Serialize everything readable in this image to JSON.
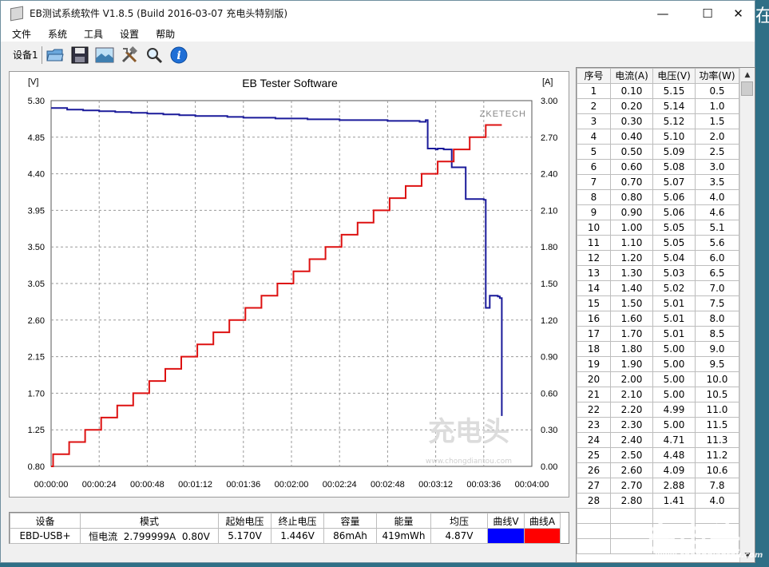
{
  "window": {
    "title": "EB测试系统软件 V1.8.5 (Build 2016-03-07 充电头特别版)",
    "controls": {
      "minimize": "—",
      "maximize": "☐",
      "close": "✕"
    }
  },
  "menu": [
    "文件",
    "系统",
    "工具",
    "设置",
    "帮助"
  ],
  "toolbar": {
    "device_label": "设备1",
    "buttons": [
      "open-folder-icon",
      "save-disk-icon",
      "landscape-image-icon",
      "tools-icon",
      "zoom-magnifier-icon",
      "info-icon"
    ]
  },
  "chart": {
    "watermark_brand": "ZKETECH",
    "watermark_site": "www.chongdiantou.com",
    "watermark_logo": "充电头",
    "left_unit": "[V]",
    "right_unit": "[A]"
  },
  "chart_data": {
    "type": "line",
    "title": "EB Tester Software",
    "xlabel": "",
    "ylabel_left": "[V]",
    "ylabel_right": "[A]",
    "x_ticks": [
      "00:00:00",
      "00:00:24",
      "00:00:48",
      "00:01:12",
      "00:01:36",
      "00:02:00",
      "00:02:24",
      "00:02:48",
      "00:03:12",
      "00:03:36",
      "00:04:00"
    ],
    "xlim_seconds": [
      0,
      240
    ],
    "y_left_ticks": [
      "5.30",
      "4.85",
      "4.40",
      "3.95",
      "3.50",
      "3.05",
      "2.60",
      "2.15",
      "1.70",
      "1.25",
      "0.80"
    ],
    "y_left_lim": [
      0.8,
      5.3
    ],
    "y_right_ticks": [
      "3.00",
      "2.70",
      "2.40",
      "2.10",
      "1.80",
      "1.50",
      "1.20",
      "0.90",
      "0.60",
      "0.30",
      "0.00"
    ],
    "y_right_lim": [
      0.0,
      3.0
    ],
    "grid": true,
    "series": [
      {
        "name": "曲线V",
        "axis": "left",
        "color": "#1a1a9a",
        "points": [
          [
            0,
            5.21
          ],
          [
            8,
            5.19
          ],
          [
            16,
            5.18
          ],
          [
            24,
            5.17
          ],
          [
            32,
            5.16
          ],
          [
            40,
            5.15
          ],
          [
            48,
            5.14
          ],
          [
            56,
            5.13
          ],
          [
            64,
            5.12
          ],
          [
            72,
            5.11
          ],
          [
            80,
            5.11
          ],
          [
            88,
            5.1
          ],
          [
            96,
            5.09
          ],
          [
            104,
            5.09
          ],
          [
            112,
            5.08
          ],
          [
            120,
            5.08
          ],
          [
            128,
            5.07
          ],
          [
            136,
            5.07
          ],
          [
            144,
            5.06
          ],
          [
            152,
            5.06
          ],
          [
            160,
            5.06
          ],
          [
            168,
            5.05
          ],
          [
            176,
            5.05
          ],
          [
            182,
            5.05
          ],
          [
            184,
            5.04
          ],
          [
            187,
            5.06
          ],
          [
            188,
            4.71
          ],
          [
            191,
            4.71
          ],
          [
            192,
            4.7
          ],
          [
            193,
            4.71
          ],
          [
            196,
            4.7
          ],
          [
            200,
            4.7
          ],
          [
            200,
            4.48
          ],
          [
            206,
            4.48
          ],
          [
            207,
            4.09
          ],
          [
            215,
            4.09
          ],
          [
            216,
            4.08
          ],
          [
            217,
            2.75
          ],
          [
            219,
            2.75
          ],
          [
            219,
            2.9
          ],
          [
            223,
            2.89
          ],
          [
            224,
            2.87
          ],
          [
            225,
            1.42
          ]
        ]
      },
      {
        "name": "曲线A",
        "axis": "right",
        "color": "#dd1111",
        "steps": [
          [
            0,
            0.0
          ],
          [
            1,
            0.1
          ],
          [
            9,
            0.2
          ],
          [
            17,
            0.3
          ],
          [
            25,
            0.4
          ],
          [
            33,
            0.5
          ],
          [
            41,
            0.6
          ],
          [
            49,
            0.7
          ],
          [
            57,
            0.8
          ],
          [
            65,
            0.9
          ],
          [
            73,
            1.0
          ],
          [
            81,
            1.1
          ],
          [
            89,
            1.2
          ],
          [
            97,
            1.3
          ],
          [
            105,
            1.4
          ],
          [
            113,
            1.5
          ],
          [
            121,
            1.6
          ],
          [
            129,
            1.7
          ],
          [
            137,
            1.8
          ],
          [
            145,
            1.9
          ],
          [
            153,
            2.0
          ],
          [
            161,
            2.1
          ],
          [
            169,
            2.2
          ],
          [
            177,
            2.3
          ],
          [
            185,
            2.4
          ],
          [
            193,
            2.5
          ],
          [
            201,
            2.6
          ],
          [
            209,
            2.7
          ],
          [
            217,
            2.8
          ],
          [
            225,
            2.8
          ]
        ]
      }
    ]
  },
  "table": {
    "headers": [
      "序号",
      "电流(A)",
      "电压(V)",
      "功率(W)"
    ],
    "rows": [
      [
        "1",
        "0.10",
        "5.15",
        "0.5"
      ],
      [
        "2",
        "0.20",
        "5.14",
        "1.0"
      ],
      [
        "3",
        "0.30",
        "5.12",
        "1.5"
      ],
      [
        "4",
        "0.40",
        "5.10",
        "2.0"
      ],
      [
        "5",
        "0.50",
        "5.09",
        "2.5"
      ],
      [
        "6",
        "0.60",
        "5.08",
        "3.0"
      ],
      [
        "7",
        "0.70",
        "5.07",
        "3.5"
      ],
      [
        "8",
        "0.80",
        "5.06",
        "4.0"
      ],
      [
        "9",
        "0.90",
        "5.06",
        "4.6"
      ],
      [
        "10",
        "1.00",
        "5.05",
        "5.1"
      ],
      [
        "11",
        "1.10",
        "5.05",
        "5.6"
      ],
      [
        "12",
        "1.20",
        "5.04",
        "6.0"
      ],
      [
        "13",
        "1.30",
        "5.03",
        "6.5"
      ],
      [
        "14",
        "1.40",
        "5.02",
        "7.0"
      ],
      [
        "15",
        "1.50",
        "5.01",
        "7.5"
      ],
      [
        "16",
        "1.60",
        "5.01",
        "8.0"
      ],
      [
        "17",
        "1.70",
        "5.01",
        "8.5"
      ],
      [
        "18",
        "1.80",
        "5.00",
        "9.0"
      ],
      [
        "19",
        "1.90",
        "5.00",
        "9.5"
      ],
      [
        "20",
        "2.00",
        "5.00",
        "10.0"
      ],
      [
        "21",
        "2.10",
        "5.00",
        "10.5"
      ],
      [
        "22",
        "2.20",
        "4.99",
        "11.0"
      ],
      [
        "23",
        "2.30",
        "5.00",
        "11.5"
      ],
      [
        "24",
        "2.40",
        "4.71",
        "11.3"
      ],
      [
        "25",
        "2.50",
        "4.48",
        "11.2"
      ],
      [
        "26",
        "2.60",
        "4.09",
        "10.6"
      ],
      [
        "27",
        "2.70",
        "2.88",
        "7.8"
      ],
      [
        "28",
        "2.80",
        "1.41",
        "4.0"
      ]
    ]
  },
  "summary": {
    "headers": [
      "设备",
      "模式",
      "起始电压",
      "终止电压",
      "容量",
      "能量",
      "均压",
      "曲线V",
      "曲线A"
    ],
    "values": [
      "EBD-USB+",
      "恒电流  2.799999A  0.80V",
      "5.170V",
      "1.446V",
      "86mAh",
      "419mWh",
      "4.87V"
    ],
    "colors": {
      "curve_v": "#0000ff",
      "curve_a": "#ff0000"
    }
  },
  "overlay": {
    "logo": "充电头",
    "site": "www.chongdiantou.com"
  }
}
